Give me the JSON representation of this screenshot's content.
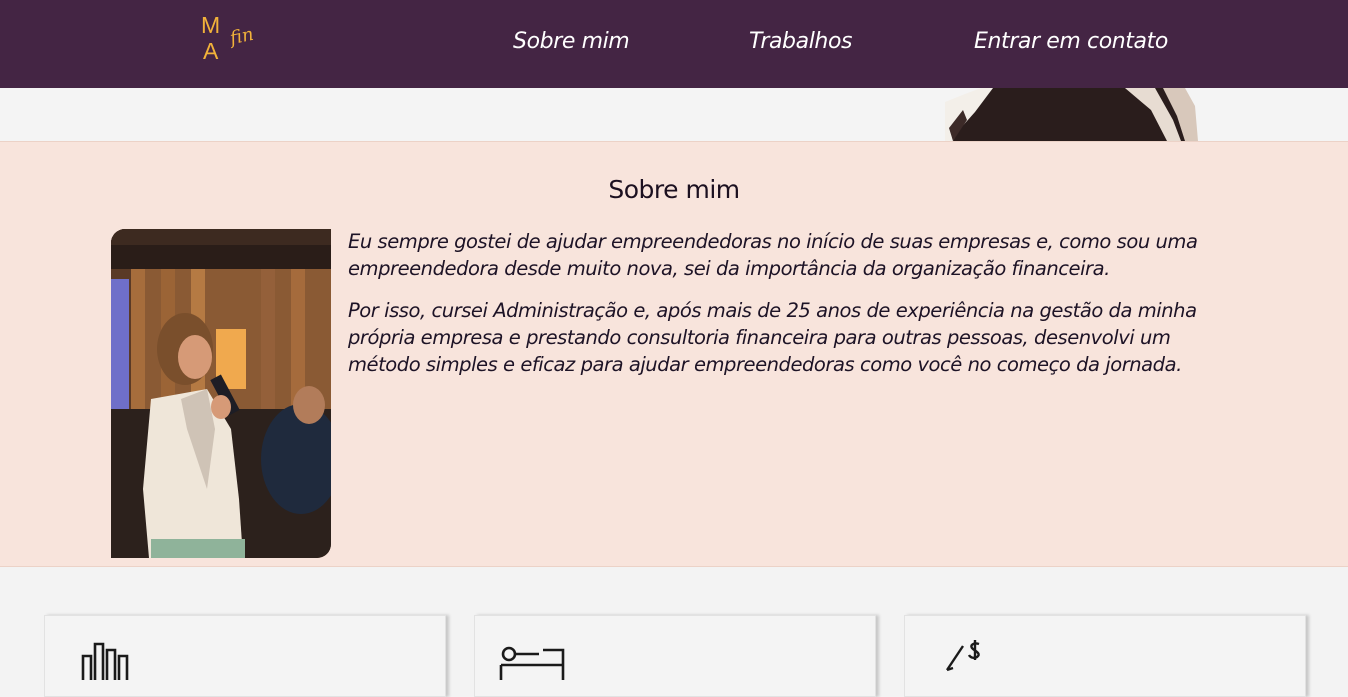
{
  "header": {
    "logo": {
      "letter_top": "M",
      "letter_bottom": "A",
      "script_text": "fin"
    },
    "nav": [
      {
        "label": "Sobre mim"
      },
      {
        "label": "Trabalhos"
      },
      {
        "label": "Entrar em contato"
      }
    ]
  },
  "about": {
    "title": "Sobre mim",
    "paragraphs": [
      "Eu sempre gostei de ajudar empreendedoras no início de suas empresas e, como sou uma empreendedora desde muito nova, sei da importância da organização financeira.",
      "Por isso, cursei Administração e, após mais de 25 anos de experiência na gestão da minha própria empresa e prestando consultoria financeira para outras pessoas, desenvolvi um método simples e eficaz para ajudar empreendedoras como você no começo da jornada."
    ]
  },
  "cards": [
    {
      "icon": "bar-chart-icon"
    },
    {
      "icon": "id-card-icon"
    },
    {
      "icon": "pen-money-icon"
    }
  ],
  "colors": {
    "header_bg": "#442544",
    "logo_accent": "#f2b23a",
    "about_bg": "#f8e4dc",
    "page_bg": "#f3f3f3"
  }
}
